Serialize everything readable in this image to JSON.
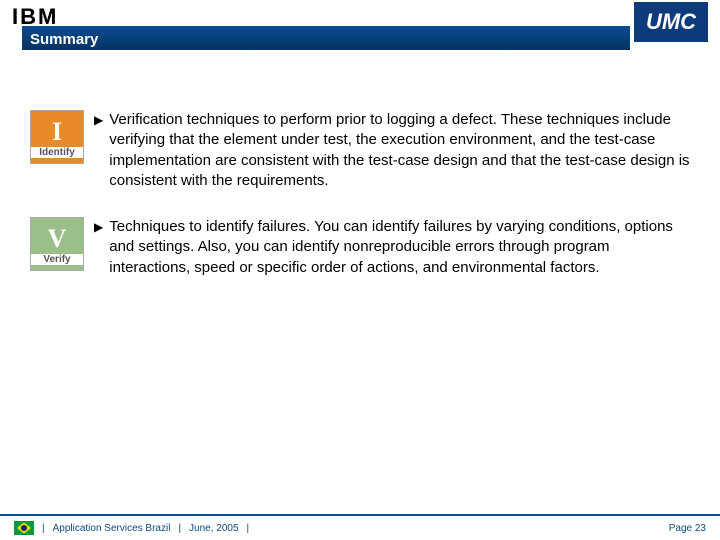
{
  "header": {
    "ibm_text": "IBM",
    "umc_text": "UMC",
    "title": "Summary"
  },
  "bullets": [
    {
      "badge_letter": "I",
      "badge_label": "Identify",
      "text": "Verification techniques to perform prior to logging a defect. These techniques include verifying that the element under test, the execution environment, and the test-case implementation are consistent with the test-case design and that the test-case design is consistent with the requirements."
    },
    {
      "badge_letter": "V",
      "badge_label": "Verify",
      "text": "Techniques to identify failures. You can identify failures by varying conditions, options and settings. Also, you can identify nonreproducible errors through program interactions, speed or specific order of actions, and environmental factors."
    }
  ],
  "footer": {
    "org": "Application Services Brazil",
    "date": "June, 2005",
    "page_label": "Page 23"
  }
}
